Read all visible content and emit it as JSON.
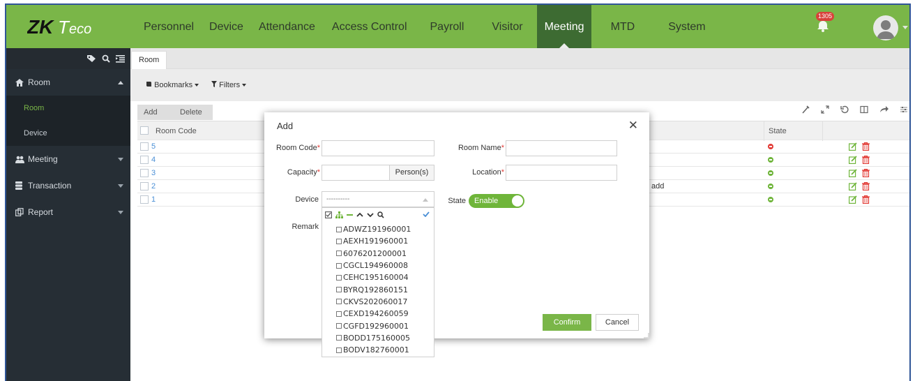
{
  "header": {
    "logo": "ZKTeco",
    "nav": [
      {
        "label": "Personnel",
        "active": false
      },
      {
        "label": "Device",
        "active": false
      },
      {
        "label": "Attendance",
        "active": false
      },
      {
        "label": "Access Control",
        "active": false
      },
      {
        "label": "Payroll",
        "active": false
      },
      {
        "label": "Visitor",
        "active": false
      },
      {
        "label": "Meeting",
        "active": true
      },
      {
        "label": "MTD",
        "active": false
      },
      {
        "label": "System",
        "active": false
      }
    ],
    "notification_count": "1305"
  },
  "sidebar": {
    "groups": [
      {
        "label": "Room",
        "icon": "home-icon",
        "expanded": true,
        "children": [
          {
            "label": "Room",
            "active": true
          },
          {
            "label": "Device",
            "active": false
          }
        ]
      },
      {
        "label": "Meeting",
        "icon": "users-icon",
        "expanded": false
      },
      {
        "label": "Transaction",
        "icon": "database-icon",
        "expanded": false
      },
      {
        "label": "Report",
        "icon": "report-icon",
        "expanded": false
      }
    ]
  },
  "tabs": [
    {
      "label": "Room"
    }
  ],
  "toolbar": {
    "bookmarks": "Bookmarks",
    "filters": "Filters"
  },
  "actions": {
    "add": "Add",
    "delete": "Delete"
  },
  "grid": {
    "headers": {
      "room_code": "Room Code",
      "state": "State"
    },
    "rows": [
      {
        "code": "5",
        "state": "disabled"
      },
      {
        "code": "4",
        "state": "enabled"
      },
      {
        "code": "3",
        "state": "enabled"
      },
      {
        "code": "2",
        "state": "enabled",
        "partial_text": "add"
      },
      {
        "code": "1",
        "state": "enabled"
      }
    ]
  },
  "modal": {
    "title": "Add",
    "room_code_label": "Room Code",
    "room_name_label": "Room Name",
    "capacity_label": "Capacity",
    "capacity_unit": "Person(s)",
    "location_label": "Location",
    "device_label": "Device",
    "device_placeholder": "----------",
    "state_label": "State",
    "state_value": "Enable",
    "remark_label": "Remark",
    "confirm": "Confirm",
    "cancel": "Cancel",
    "room_code_value": "",
    "room_name_value": "",
    "capacity_value": "",
    "location_value": ""
  },
  "device_options": [
    "ADWZ191960001",
    "AEXH191960001",
    "6076201200001",
    "CGCL194960008",
    "CEHC195160004",
    "BYRQ192860151",
    "CKVS202060017",
    "CEXD194260059",
    "CGFD192960001",
    "BODD175160005",
    "BODV182760001"
  ],
  "colors": {
    "brand_green": "#7ab648",
    "active_nav": "#3d6b32",
    "sidebar_bg": "#262e35",
    "link_blue": "#4a8fd6",
    "danger_red": "#e23b36"
  }
}
